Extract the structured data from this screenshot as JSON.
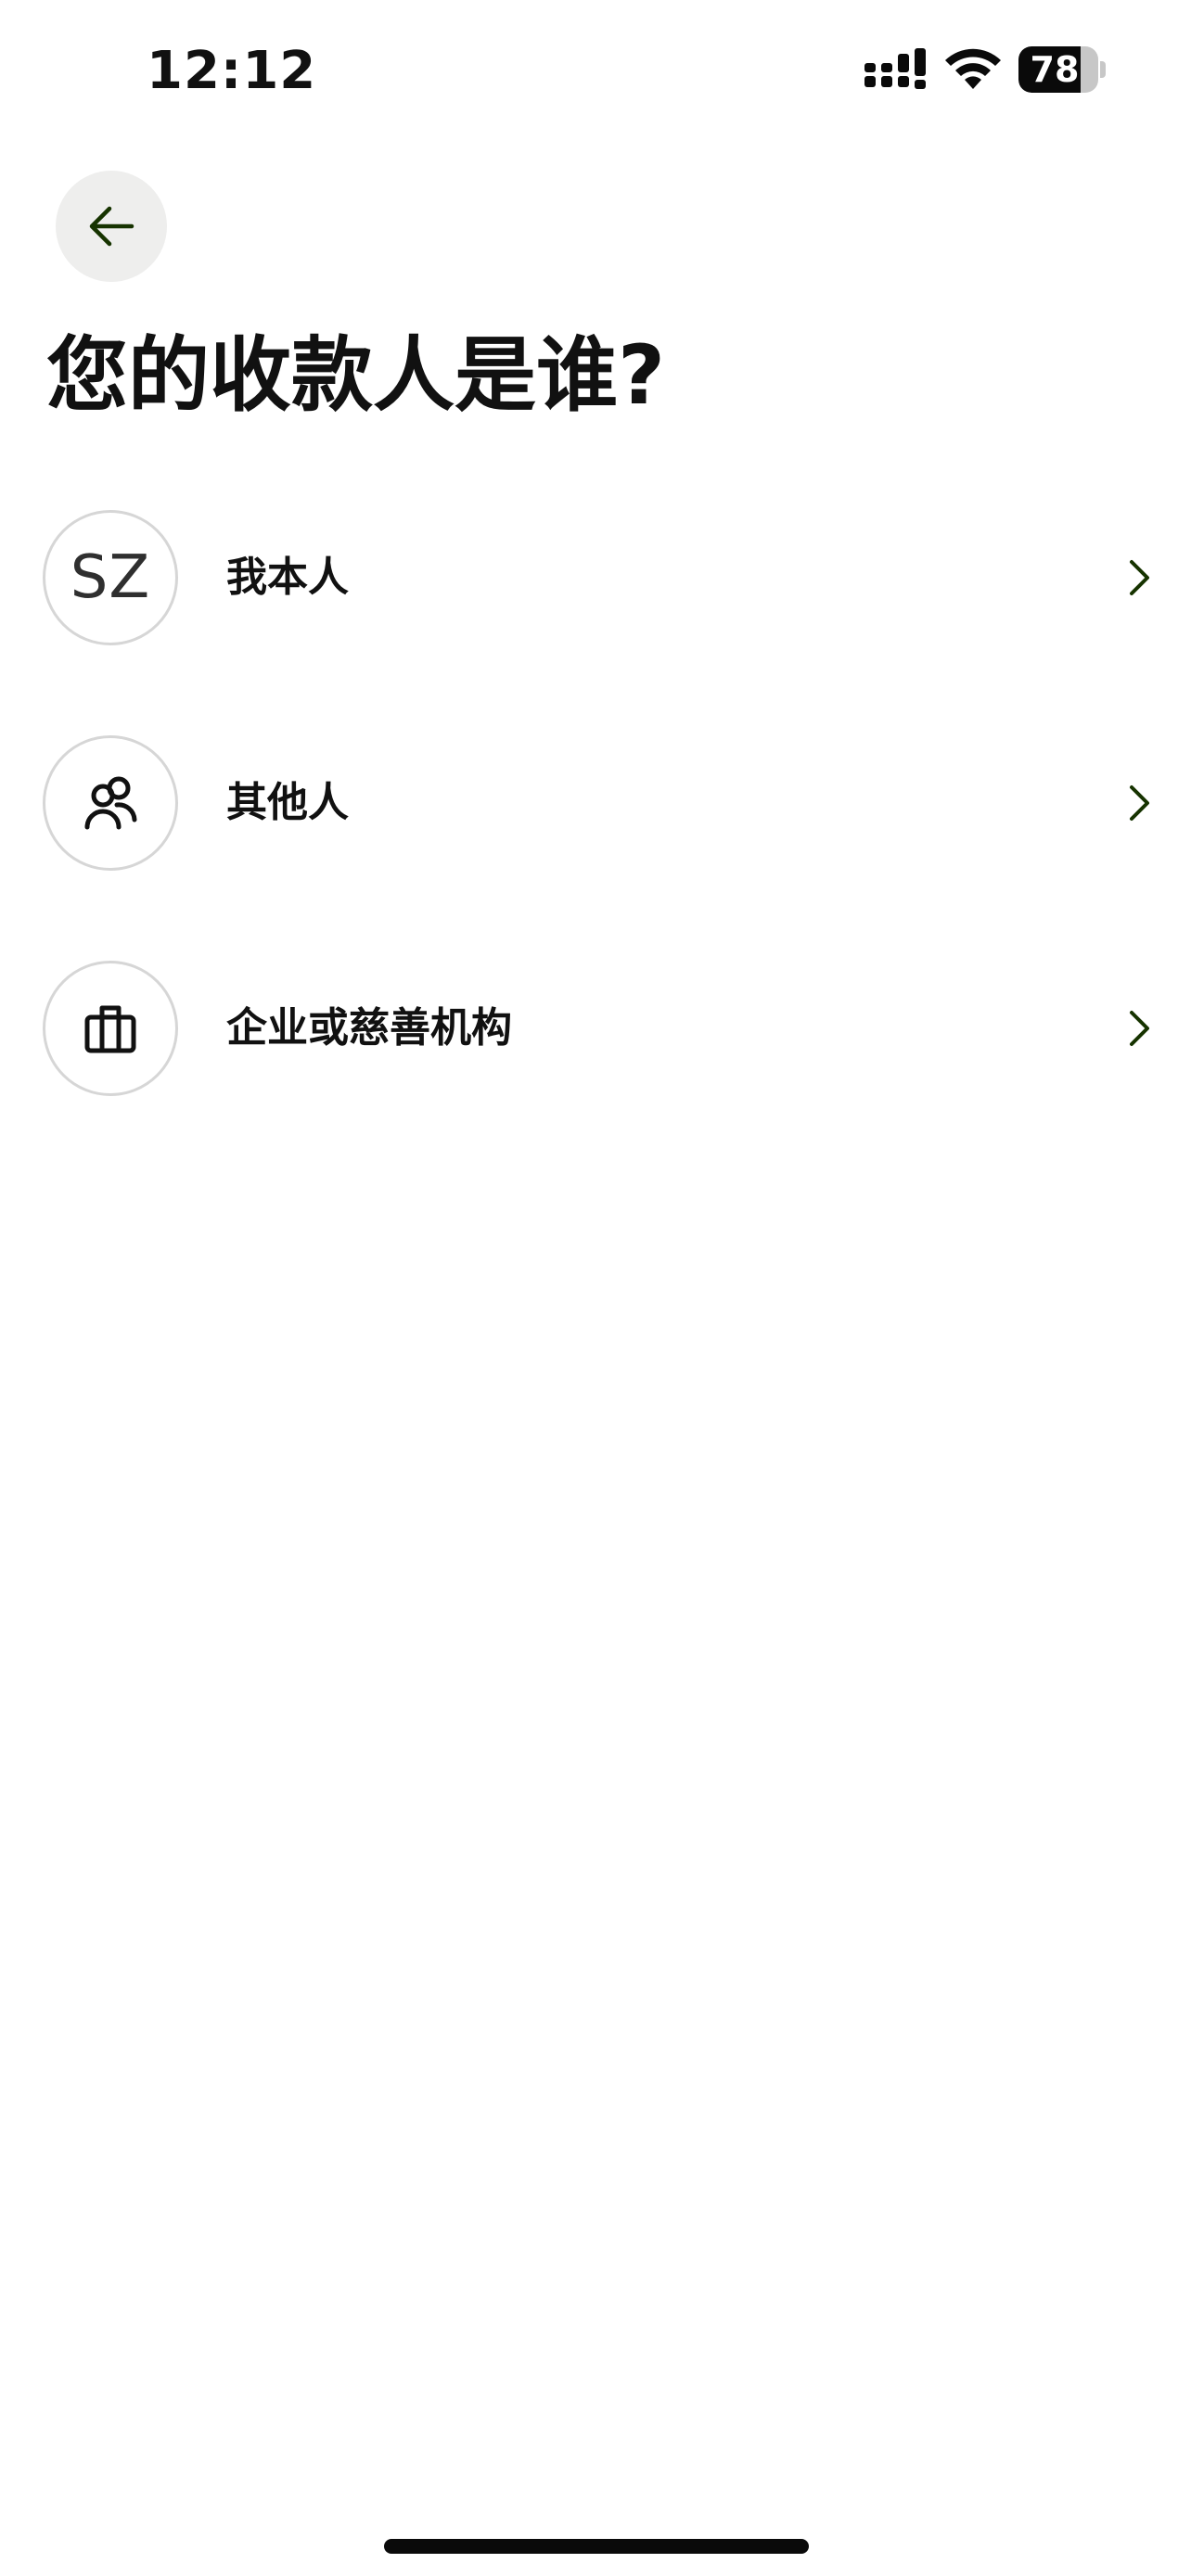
{
  "status_bar": {
    "time": "12:12",
    "battery_level": "78",
    "battery_fraction": 0.78
  },
  "header": {
    "back_icon": "arrow-left-icon",
    "title": "您的收款人是谁?"
  },
  "options": [
    {
      "avatar_type": "initials",
      "initials": "SZ",
      "label": "我本人",
      "chevron_icon": "chevron-right-icon"
    },
    {
      "avatar_type": "icon",
      "icon": "people-icon",
      "label": "其他人",
      "chevron_icon": "chevron-right-icon"
    },
    {
      "avatar_type": "icon",
      "icon": "briefcase-icon",
      "label": "企业或慈善机构",
      "chevron_icon": "chevron-right-icon"
    }
  ],
  "colors": {
    "accent_dark_green": "#163300",
    "back_button_bg": "#eeeeed",
    "avatar_border": "#d6d6d6",
    "text_primary": "#111111"
  }
}
